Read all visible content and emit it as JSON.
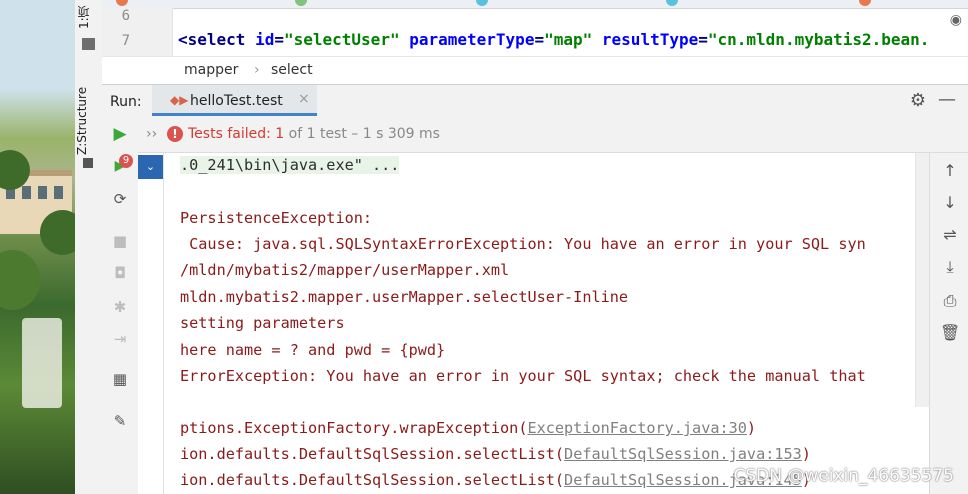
{
  "side_strip": {
    "project_label": "1:项",
    "structure_label": "Z:Structure"
  },
  "editor": {
    "line_numbers": [
      "6",
      "7"
    ],
    "code": {
      "open": "<",
      "tag": "select",
      "a1": "id",
      "v1": "\"selectUser\"",
      "a2": "parameterType",
      "v2": "\"map\"",
      "a3": "resultType",
      "v3": "\"cn.mldn.mybatis2.bean."
    },
    "breadcrumb": [
      "mapper",
      "›",
      "select"
    ]
  },
  "run_bar": {
    "label": "Run:",
    "tab_label": "helloTest.test",
    "close": "×"
  },
  "status": {
    "chevron": "››",
    "fail_icon": "!",
    "prefix": "Tests failed:",
    "count": "1",
    "of_text": "of 1 test",
    "duration": "– 1 s 309 ms"
  },
  "left_badge": "9",
  "console": {
    "lines": [
      ".0_241\\bin\\java.exe\" ...",
      "",
      "PersistenceException:",
      " Cause: java.sql.SQLSyntaxErrorException: You have an error in your SQL syn",
      "/mldn/mybatis2/mapper/userMapper.xml",
      "mldn.mybatis2.mapper.userMapper.selectUser-Inline",
      "setting parameters",
      "here name = ? and pwd = {pwd}",
      "ErrorException: You have an error in your SQL syntax; check the manual that",
      ""
    ],
    "trace": [
      {
        "pre": "ptions.ExceptionFactory.wrapException(",
        "link": "ExceptionFactory.java:30",
        "post": ")"
      },
      {
        "pre": "ion.defaults.DefaultSqlSession.selectList(",
        "link": "DefaultSqlSession.java:153",
        "post": ")"
      },
      {
        "pre": "ion.defaults.DefaultSqlSession.selectList(",
        "link": "DefaultSqlSession.java:145",
        "post": ")"
      }
    ]
  },
  "watermark": "CSDN @weixin_46635575",
  "colors": {
    "accent": "#4083c9",
    "error": "#d23b32",
    "console_text": "#8b1a1a"
  }
}
